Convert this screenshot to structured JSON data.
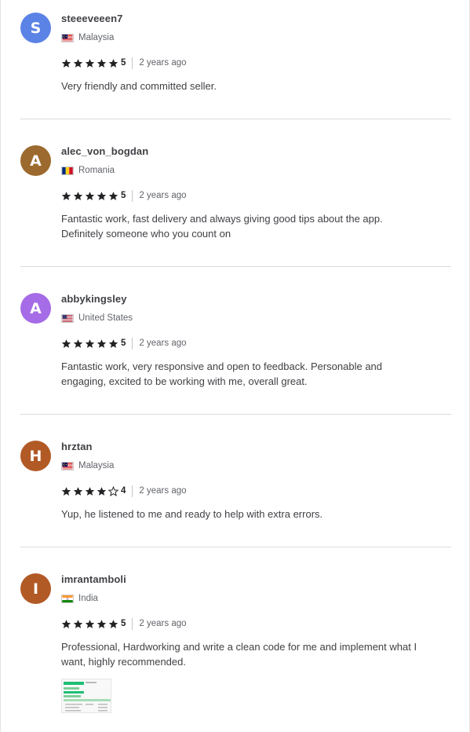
{
  "reviews": [
    {
      "initial": "S",
      "avatar_color": "#5b83e6",
      "username": "steeeveeen7",
      "country": "Malaysia",
      "flag": "malaysia",
      "rating": 5,
      "rating_text": "5",
      "time": "2 years ago",
      "text_lines": [
        "Very friendly and committed seller."
      ]
    },
    {
      "initial": "A",
      "avatar_color": "#9c6a2e",
      "username": "alec_von_bogdan",
      "country": "Romania",
      "flag": "romania",
      "rating": 5,
      "rating_text": "5",
      "time": "2 years ago",
      "text_lines": [
        "Fantastic work, fast delivery and always giving good tips about the app.",
        "Definitely someone who you count on"
      ]
    },
    {
      "initial": "A",
      "avatar_color": "#a66be6",
      "username": "abbykingsley",
      "country": "United States",
      "flag": "us",
      "rating": 5,
      "rating_text": "5",
      "time": "2 years ago",
      "text_lines": [
        "Fantastic work, very responsive and open to feedback. Personable and",
        "engaging, excited to be working with me, overall great."
      ]
    },
    {
      "initial": "H",
      "avatar_color": "#b25a26",
      "username": "hrztan",
      "country": "Malaysia",
      "flag": "malaysia",
      "rating": 4,
      "rating_text": "4",
      "time": "2 years ago",
      "text_lines": [
        "Yup, he listened to me and ready to help with extra errors."
      ]
    },
    {
      "initial": "I",
      "avatar_color": "#b25a26",
      "username": "imrantamboli",
      "country": "India",
      "flag": "india",
      "rating": 5,
      "rating_text": "5",
      "time": "2 years ago",
      "text_lines": [
        "Professional, Hardworking and write a clean code for me and implement what I",
        "want, highly recommended."
      ],
      "has_attachment": true
    }
  ],
  "colors": {
    "star": "#222325",
    "star_empty_stroke": "#222325",
    "divider": "#dadbdd"
  }
}
